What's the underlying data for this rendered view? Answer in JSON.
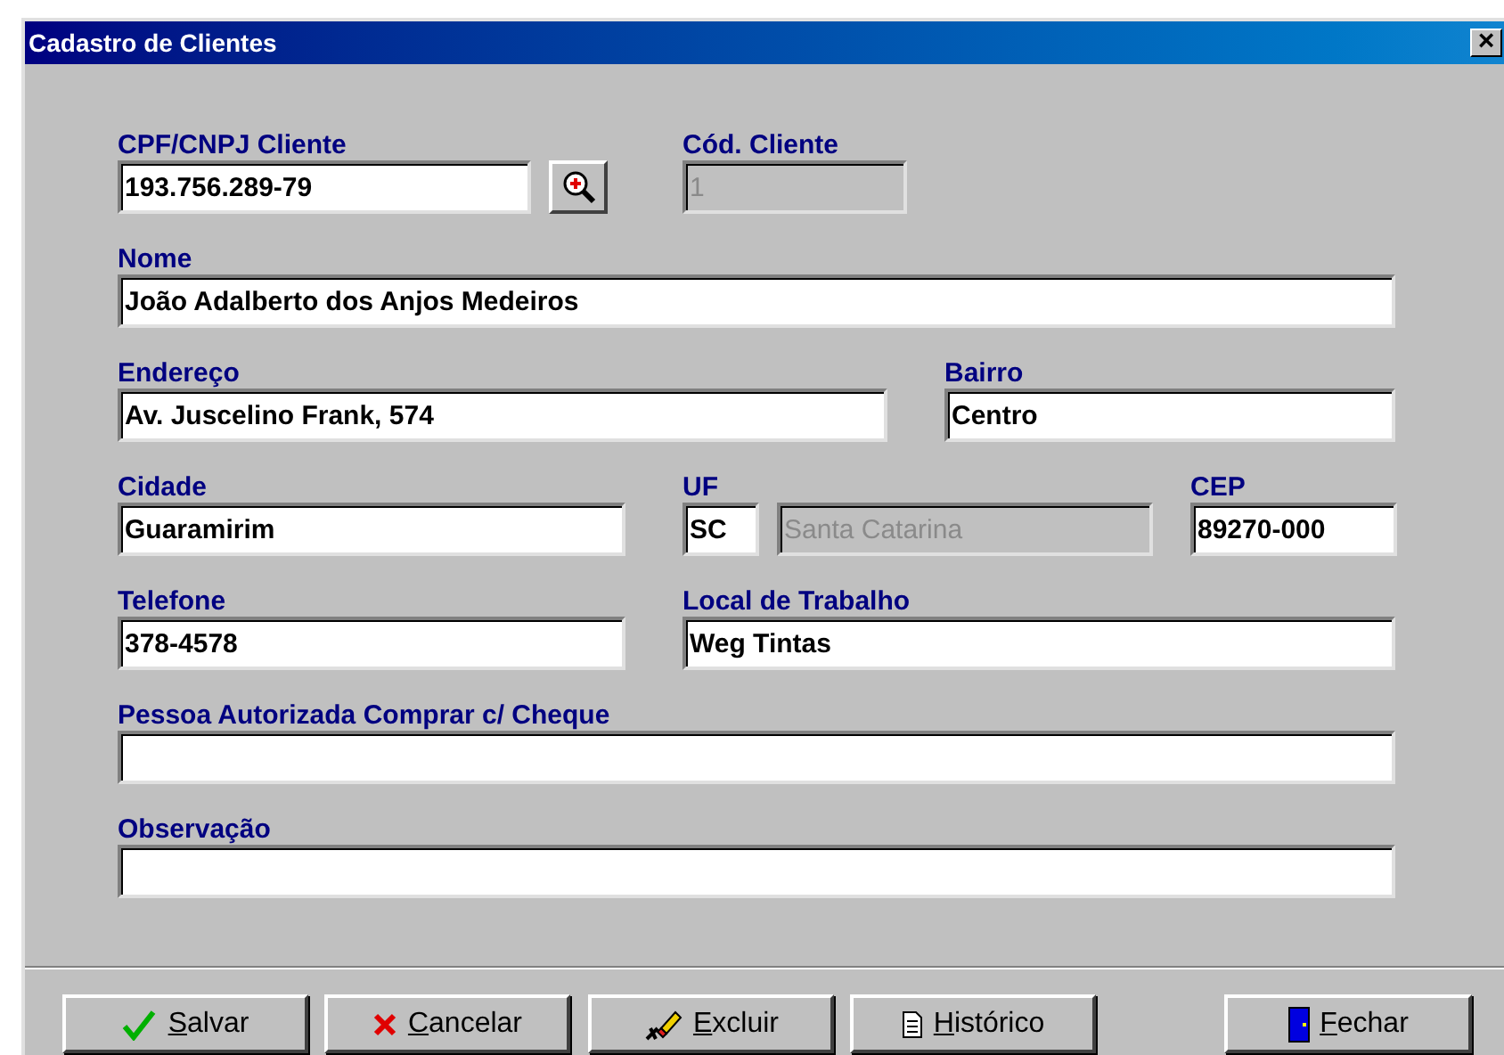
{
  "window": {
    "title": "Cadastro de Clientes",
    "close": "×"
  },
  "rows": [
    [
      {
        "kind": "field",
        "label": "CPF/CNPJ Cliente",
        "value": "193.756.289-79",
        "disabled": false
      },
      {
        "kind": "search"
      },
      {
        "kind": "field",
        "label": "Cód. Cliente",
        "value": "1",
        "disabled": true
      }
    ],
    [
      {
        "kind": "field",
        "label": "Nome",
        "value": "João Adalberto dos Anjos Medeiros",
        "disabled": false
      }
    ],
    [
      {
        "kind": "field",
        "label": "Endereço",
        "value": "Av. Juscelino Frank, 574",
        "disabled": false
      },
      {
        "kind": "field",
        "label": "Bairro",
        "value": "Centro",
        "disabled": false
      }
    ],
    [
      {
        "kind": "field",
        "label": "Cidade",
        "value": "Guaramirim",
        "disabled": false
      },
      {
        "kind": "field",
        "label": "UF",
        "value": "SC",
        "disabled": false
      },
      {
        "kind": "field",
        "value": "Santa Catarina",
        "disabled": true
      },
      {
        "kind": "field",
        "label": "CEP",
        "value": "89270-000",
        "disabled": false
      }
    ],
    [
      {
        "kind": "field",
        "label": "Telefone",
        "value": "378-4578",
        "disabled": false
      },
      {
        "kind": "field",
        "label": "Local de Trabalho",
        "value": "Weg Tintas",
        "disabled": false
      }
    ],
    [
      {
        "kind": "field",
        "label": "Pessoa Autorizada Comprar c/ Cheque",
        "disabled": false
      }
    ],
    [
      {
        "kind": "field",
        "label": "Observação",
        "disabled": false
      }
    ]
  ],
  "buttons": [
    {
      "label": "Salvar"
    },
    {
      "label": "Cancelar"
    },
    {
      "label": "Excluir"
    },
    {
      "label": "Histórico"
    },
    {
      "label": "Fechar"
    }
  ]
}
